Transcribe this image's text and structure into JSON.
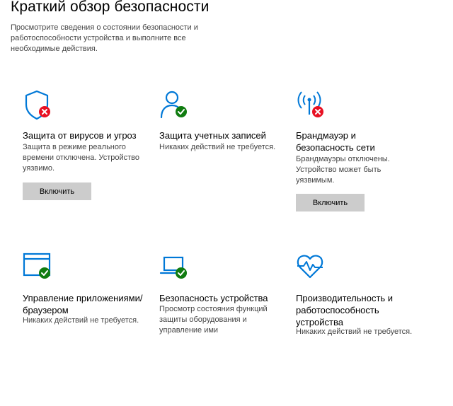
{
  "header": {
    "title": "Краткий обзор безопасности",
    "description": "Просмотрите сведения о состоянии безопасности и работоспособности устройства и выполните все необходимые действия."
  },
  "colors": {
    "accent": "#0078d7",
    "error": "#e81123",
    "ok": "#107c10",
    "button_bg": "#cccccc"
  },
  "cards": [
    {
      "icon": "shield-error-icon",
      "title": "Защита от вирусов и угроз",
      "status": "Защита в режиме реального времени отключена. Устройство уязвимо.",
      "button": "Включить",
      "state": "error"
    },
    {
      "icon": "account-ok-icon",
      "title": "Защита учетных записей",
      "status": "Никаких действий не требуется.",
      "state": "ok"
    },
    {
      "icon": "firewall-error-icon",
      "title": "Брандмауэр и безопасность сети",
      "status": "Брандмауэры отключены. Устройство может быть уязвимым.",
      "button": "Включить",
      "state": "error"
    },
    {
      "icon": "app-browser-ok-icon",
      "title": "Управление приложениями/браузером",
      "status": "Никаких действий не требуется.",
      "state": "ok"
    },
    {
      "icon": "device-security-ok-icon",
      "title": "Безопасность устройства",
      "status": "Просмотр состояния функций защиты оборудования и управление ими",
      "state": "ok"
    },
    {
      "icon": "device-health-icon",
      "title": "Производительность и работоспособность устройства",
      "status": "Никаких действий не требуется.",
      "state": "ok"
    }
  ]
}
